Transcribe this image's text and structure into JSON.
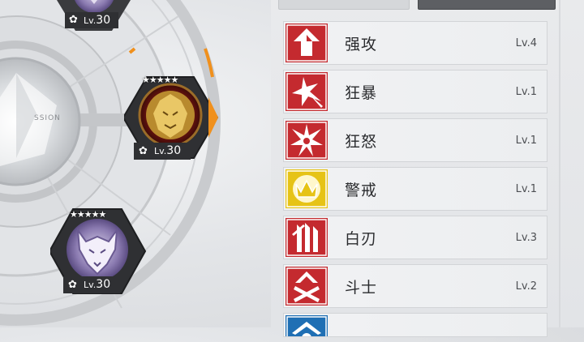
{
  "skills": [
    {
      "name": "强攻",
      "level": "Lv.4",
      "color": "#c42a2f",
      "icon": "arrow-up-icon"
    },
    {
      "name": "狂暴",
      "level": "Lv.1",
      "color": "#c42a2f",
      "icon": "star-burst-icon"
    },
    {
      "name": "狂怒",
      "level": "Lv.1",
      "color": "#c42a2f",
      "icon": "fury-star-icon"
    },
    {
      "name": "警戒",
      "level": "Lv.1",
      "color": "#e6c316",
      "icon": "crown-icon"
    },
    {
      "name": "白刃",
      "level": "Lv.3",
      "color": "#c42a2f",
      "icon": "blades-icon"
    },
    {
      "name": "斗士",
      "level": "Lv.2",
      "color": "#c42a2f",
      "icon": "crossed-swords-icon"
    },
    {
      "name": "",
      "level": "",
      "color": "#1f6fb4",
      "icon": "shield-icon"
    }
  ],
  "wheel": {
    "center_text": "SSION",
    "units": [
      {
        "level_prefix": "Lv.",
        "level": "30",
        "stars": "★★★★★",
        "emblem": "lion-emblem-icon",
        "selected": true
      },
      {
        "level_prefix": "Lv.",
        "level": "30",
        "stars": "★★★★★",
        "emblem": "wolf-emblem-icon",
        "selected": false
      },
      {
        "level_prefix": "Lv.",
        "level": "30",
        "stars": "",
        "emblem": "wolf-emblem-icon",
        "selected": false
      }
    ]
  },
  "colors": {
    "accent_orange": "#f0901c",
    "dark_hex": "#2f3033"
  }
}
